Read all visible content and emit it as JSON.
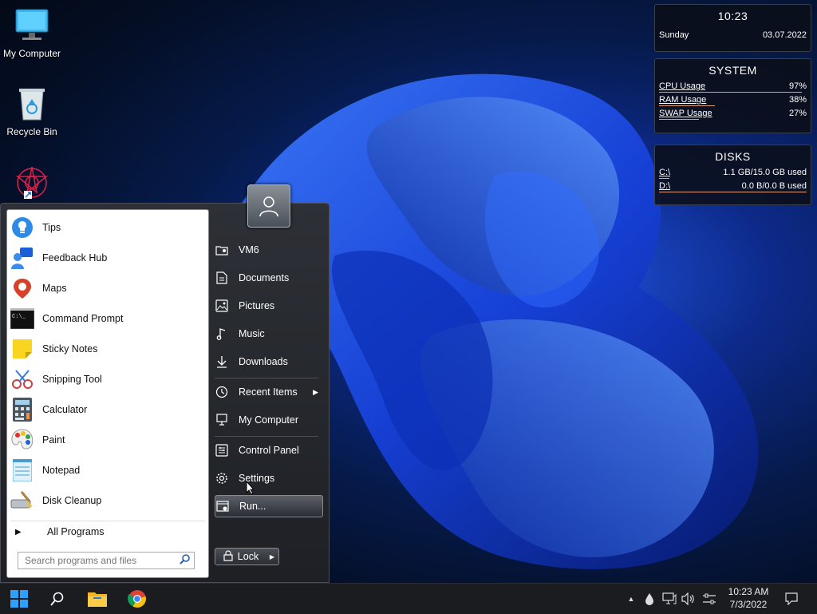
{
  "desktop": {
    "icons": [
      {
        "label": "My Computer"
      },
      {
        "label": "Recycle Bin"
      }
    ]
  },
  "widgets": {
    "clock": {
      "time": "10:23",
      "day": "Sunday",
      "date": "03.07.2022"
    },
    "system": {
      "title": "SYSTEM",
      "rows": [
        {
          "label": "CPU Usage",
          "value": "97%",
          "fraction": 0.97
        },
        {
          "label": "RAM Usage",
          "value": "38%",
          "fraction": 0.38
        },
        {
          "label": "SWAP Usage",
          "value": "27%",
          "fraction": 0.27
        }
      ]
    },
    "disks": {
      "title": "DISKS",
      "rows": [
        {
          "label": "C:\\",
          "value": "1.1 GB/15.0 GB used",
          "fraction": 0.07
        },
        {
          "label": "D:\\",
          "value": "0.0 B/0.0 B used",
          "fraction": 0.0
        }
      ]
    }
  },
  "start_menu": {
    "programs": [
      {
        "label": "Tips",
        "icon": "tips-icon"
      },
      {
        "label": "Feedback Hub",
        "icon": "feedback-hub-icon"
      },
      {
        "label": "Maps",
        "icon": "maps-icon"
      },
      {
        "label": "Command Prompt",
        "icon": "command-prompt-icon"
      },
      {
        "label": "Sticky Notes",
        "icon": "sticky-notes-icon"
      },
      {
        "label": "Snipping Tool",
        "icon": "snipping-tool-icon"
      },
      {
        "label": "Calculator",
        "icon": "calculator-icon"
      },
      {
        "label": "Paint",
        "icon": "paint-icon"
      },
      {
        "label": "Notepad",
        "icon": "notepad-icon"
      },
      {
        "label": "Disk Cleanup",
        "icon": "disk-cleanup-icon"
      }
    ],
    "all_programs": "All Programs",
    "search_placeholder": "Search programs and files",
    "places": [
      {
        "label": "VM6",
        "icon": "user-folder-icon"
      },
      {
        "label": "Documents",
        "icon": "document-icon"
      },
      {
        "label": "Pictures",
        "icon": "picture-icon"
      },
      {
        "label": "Music",
        "icon": "music-note-icon"
      },
      {
        "label": "Downloads",
        "icon": "download-arrow-icon"
      },
      {
        "label": "Recent Items",
        "icon": "clock-icon"
      },
      {
        "label": "My Computer",
        "icon": "computer-icon"
      },
      {
        "label": "Control Panel",
        "icon": "control-panel-icon"
      },
      {
        "label": "Settings",
        "icon": "gear-icon"
      },
      {
        "label": "Run...",
        "icon": "run-icon"
      }
    ],
    "lock_label": "Lock"
  },
  "taskbar": {
    "clock_time": "10:23 AM",
    "clock_date": "7/3/2022"
  }
}
